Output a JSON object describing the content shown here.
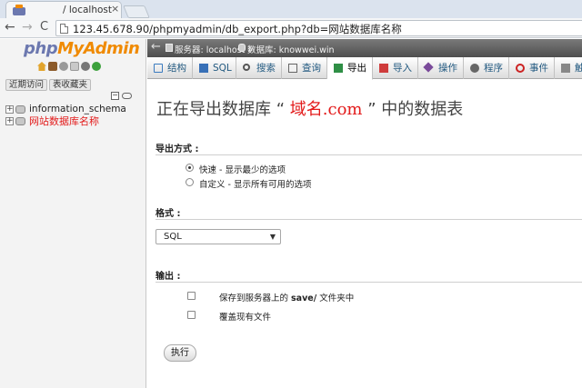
{
  "browser": {
    "tab_title": "/ localhost",
    "tab_close": "×",
    "url": "123.45.678.90/phpmyadmin/db_export.php?db=网站数据库名称",
    "nav_back": "←",
    "nav_forward": "→",
    "nav_reload": "C"
  },
  "sidebar": {
    "logo_php": "php",
    "logo_my": "My",
    "logo_admin": "Admin",
    "tabs": [
      {
        "label": "近期访问"
      },
      {
        "label": "表收藏夹"
      }
    ],
    "collapse_symbol": "−",
    "databases": [
      {
        "name": "information_schema",
        "expander": "+",
        "active": false
      },
      {
        "name": "网站数据库名称",
        "expander": "+",
        "active": true
      }
    ]
  },
  "breadcrumb": {
    "back": "←",
    "server": "服务器: localhost »",
    "database": "数据库: knowwei.win"
  },
  "menu": [
    {
      "label": "结构",
      "icon": "structure-icon"
    },
    {
      "label": "SQL",
      "icon": "sql-icon"
    },
    {
      "label": "搜索",
      "icon": "search-icon"
    },
    {
      "label": "查询",
      "icon": "query-icon"
    },
    {
      "label": "导出",
      "icon": "export-icon",
      "active": true
    },
    {
      "label": "导入",
      "icon": "import-icon"
    },
    {
      "label": "操作",
      "icon": "operations-icon"
    },
    {
      "label": "程序",
      "icon": "routines-icon"
    },
    {
      "label": "事件",
      "icon": "events-icon"
    },
    {
      "label": "触",
      "icon": "triggers-icon"
    }
  ],
  "main": {
    "heading_prefix": "正在导出数据库 “",
    "heading_db": "域名.com",
    "heading_suffix": "” 中的数据表",
    "export_method_label": "导出方式 :",
    "export_methods": [
      {
        "label": "快速 - 显示最少的选项",
        "checked": true
      },
      {
        "label": "自定义 - 显示所有可用的选项",
        "checked": false
      }
    ],
    "format_label": "格式 :",
    "format_value": "SQL",
    "format_arrow": "▼",
    "output_label": "输出 :",
    "output_options": [
      {
        "prefix": "保存到服务器上的 ",
        "bold": "save/",
        "suffix": " 文件夹中"
      },
      {
        "prefix": "覆盖现有文件",
        "bold": "",
        "suffix": ""
      }
    ],
    "go_button": "执行"
  },
  "colors": {
    "accent_red": "#e31b1b",
    "link_blue": "#235a81",
    "logo_blue": "#6c78af",
    "logo_orange": "#f08a00"
  }
}
